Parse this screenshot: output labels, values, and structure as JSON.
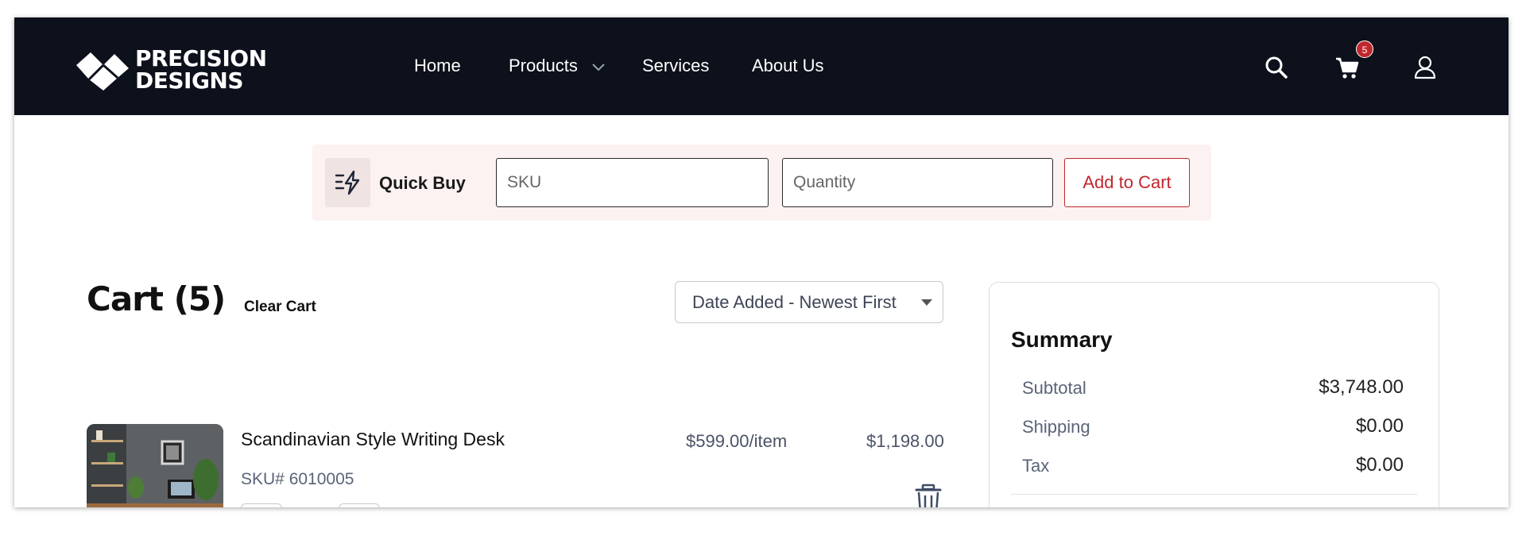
{
  "brand": {
    "line1": "PRECISION",
    "line2": "DESIGNS"
  },
  "nav": {
    "home": "Home",
    "products": "Products",
    "services": "Services",
    "about": "About Us"
  },
  "header": {
    "cart_count": "5"
  },
  "quick_buy": {
    "label": "Quick Buy",
    "sku_placeholder": "SKU",
    "quantity_placeholder": "Quantity",
    "add_button": "Add to Cart"
  },
  "cart": {
    "title": "Cart (5)",
    "clear_label": "Clear Cart",
    "sort_value": "Date Added - Newest First",
    "items": [
      {
        "name": "Scandinavian Style Writing Desk",
        "sku": "SKU# 6010005",
        "unit_price": "$599.00/item",
        "total": "$1,198.00"
      }
    ]
  },
  "summary": {
    "title": "Summary",
    "rows": [
      {
        "label": "Subtotal",
        "value": "$3,748.00"
      },
      {
        "label": "Shipping",
        "value": "$0.00"
      },
      {
        "label": "Tax",
        "value": "$0.00"
      }
    ]
  },
  "colors": {
    "header_bg": "#0d111c",
    "accent_red": "#c0272d",
    "quickbuy_bg": "#fbf2f1"
  },
  "icons": [
    "logo-mark-icon",
    "chevron-down-icon",
    "search-icon",
    "cart-icon",
    "user-icon",
    "quick-buy-icon",
    "trash-icon"
  ]
}
